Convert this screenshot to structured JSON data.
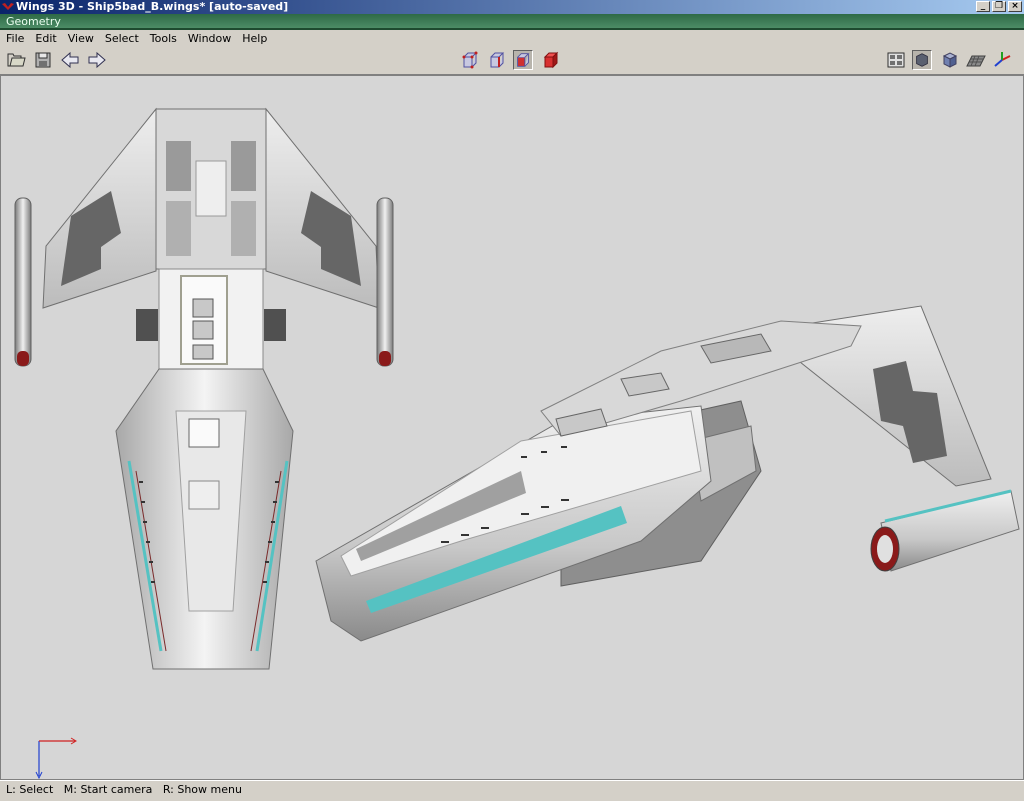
{
  "window": {
    "title": "Wings 3D - Ship5bad_B.wings* [auto-saved]",
    "buttons": {
      "minimize": "_",
      "restore": "❐",
      "close": "×"
    }
  },
  "geometry_bar": {
    "label": "Geometry"
  },
  "menu": {
    "items": [
      "File",
      "Edit",
      "View",
      "Select",
      "Tools",
      "Window",
      "Help"
    ]
  },
  "toolbar": {
    "left": [
      "open-folder-icon",
      "save-disk-icon",
      "undo-arrow-icon",
      "redo-arrow-icon"
    ],
    "center": [
      "vertex-mode-icon",
      "edge-mode-icon",
      "face-mode-icon",
      "body-mode-icon"
    ],
    "right": [
      "workmode-icon",
      "smooth-shading-icon",
      "flat-shading-icon",
      "groundplane-icon",
      "axes-icon"
    ],
    "selected_mode": "face-mode-icon"
  },
  "status": {
    "text": "L: Select   M: Start camera   R: Show menu"
  },
  "colors": {
    "title_start": "#0a246a",
    "title_end": "#a6caf0",
    "geometry_bar": "#3a7a55",
    "viewport": "#d6d6d6",
    "accent_cyan": "#55c2c2"
  }
}
